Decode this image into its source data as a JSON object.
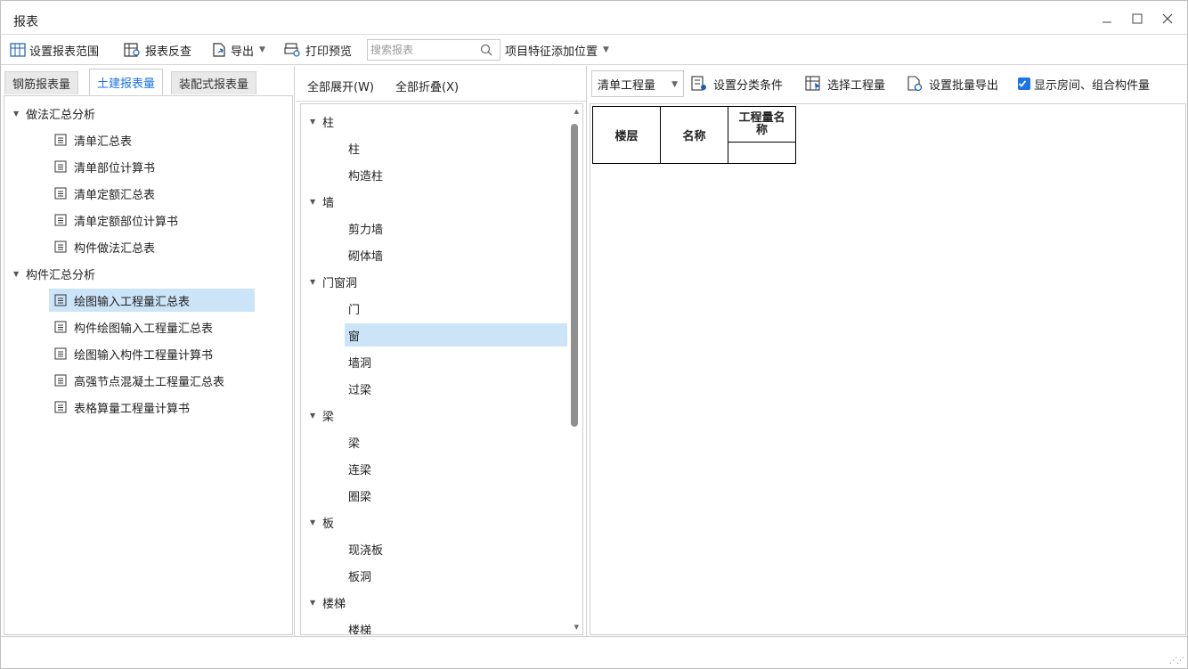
{
  "window": {
    "title": "报表",
    "controls": {
      "minimize": "_",
      "maximize": "☐",
      "close": "✕"
    }
  },
  "toolbar": {
    "set_range": "设置报表范围",
    "reverse_check": "报表反查",
    "export": "导出",
    "print_preview": "打印预览",
    "search_placeholder": "搜索报表",
    "add_feature_position": "项目特征添加位置"
  },
  "left_tabs": [
    "钢筋报表量",
    "土建报表量",
    "装配式报表量"
  ],
  "left_tree": {
    "group1": {
      "label": "做法汇总分析",
      "items": [
        "清单汇总表",
        "清单部位计算书",
        "清单定额汇总表",
        "清单定额部位计算书",
        "构件做法汇总表"
      ]
    },
    "group2": {
      "label": "构件汇总分析",
      "items": [
        "绘图输入工程量汇总表",
        "构件绘图输入工程量汇总表",
        "绘图输入构件工程量计算书",
        "高强节点混凝土工程量汇总表",
        "表格算量工程量计算书"
      ]
    },
    "selected": "绘图输入工程量汇总表"
  },
  "middle": {
    "expand_all": "全部展开(W)",
    "collapse_all": "全部折叠(X)",
    "tree": {
      "g1": {
        "label": "柱",
        "items": [
          "柱",
          "构造柱"
        ]
      },
      "g2": {
        "label": "墙",
        "items": [
          "剪力墙",
          "砌体墙"
        ]
      },
      "g3": {
        "label": "门窗洞",
        "items": [
          "门",
          "窗",
          "墙洞",
          "过梁"
        ]
      },
      "g4": {
        "label": "梁",
        "items": [
          "梁",
          "连梁",
          "圈梁"
        ]
      },
      "g5": {
        "label": "板",
        "items": [
          "现浇板",
          "板洞"
        ]
      },
      "g6": {
        "label": "楼梯",
        "items": [
          "楼梯"
        ]
      }
    },
    "selected": "窗"
  },
  "right": {
    "combo_value": "清单工程量",
    "set_classification": "设置分类条件",
    "select_quantity": "选择工程量",
    "batch_export": "设置批量导出",
    "show_rooms_label": "显示房间、组合构件量",
    "show_rooms_checked": true,
    "table": {
      "col_floor": "楼层",
      "col_name": "名称",
      "col_qty_name": "工程量名称"
    }
  },
  "colors": {
    "accent": "#1a73e8",
    "selection": "#cce4f7",
    "scrollbar": "#8f8f8f"
  }
}
